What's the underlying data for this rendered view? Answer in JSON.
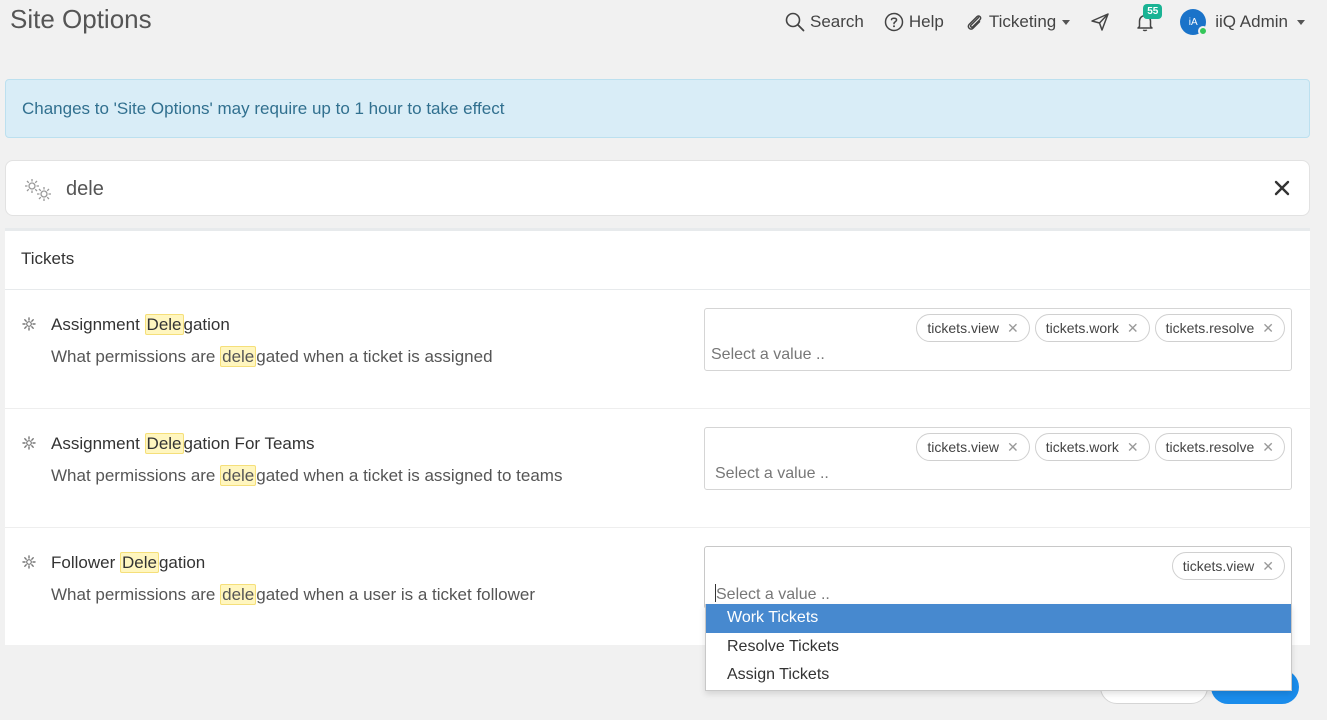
{
  "header": {
    "title": "Site Options",
    "nav": {
      "search": "Search",
      "help": "Help",
      "ticketing": "Ticketing",
      "notifications_count": "55",
      "avatar_initials": "iA",
      "user_name": "iiQ Admin"
    }
  },
  "alert": {
    "message": "Changes to 'Site Options' may require up to 1 hour to take effect"
  },
  "search": {
    "value": "dele"
  },
  "panel": {
    "title": "Tickets",
    "rows": [
      {
        "title_pre": "Assignment ",
        "title_mark": "Dele",
        "title_post": "gation",
        "desc_pre": "What permissions are ",
        "desc_mark": "dele",
        "desc_post": "gated when a ticket is assigned",
        "chips": [
          "tickets.view",
          "tickets.work",
          "tickets.resolve"
        ],
        "placeholder": "Select a value .."
      },
      {
        "title_pre": "Assignment ",
        "title_mark": "Dele",
        "title_post": "gation For Teams",
        "desc_pre": "What permissions are ",
        "desc_mark": "dele",
        "desc_post": "gated when a ticket is assigned to teams",
        "chips": [
          "tickets.view",
          "tickets.work",
          "tickets.resolve"
        ],
        "placeholder": "Select a value .."
      },
      {
        "title_pre": "Follower ",
        "title_mark": "Dele",
        "title_post": "gation",
        "desc_pre": "What permissions are ",
        "desc_mark": "dele",
        "desc_post": "gated when a user is a ticket follower",
        "chips": [
          "tickets.view"
        ],
        "placeholder": "Select a value .."
      }
    ]
  },
  "dropdown": {
    "options": [
      "Work Tickets",
      "Resolve Tickets",
      "Assign Tickets"
    ],
    "highlighted": "Work Tickets"
  },
  "colors": {
    "accent": "#4789cf",
    "badge": "#1ab394",
    "alert_bg": "#d9edf7",
    "alert_text": "#31708f",
    "highlight": "#fff6bf"
  },
  "icons": {
    "search": "search-icon",
    "help": "help-icon",
    "ticketing": "paperclip-icon",
    "send": "paper-plane-icon",
    "notifications": "bell-icon",
    "settings": "gear-icon",
    "clear": "close-icon"
  }
}
